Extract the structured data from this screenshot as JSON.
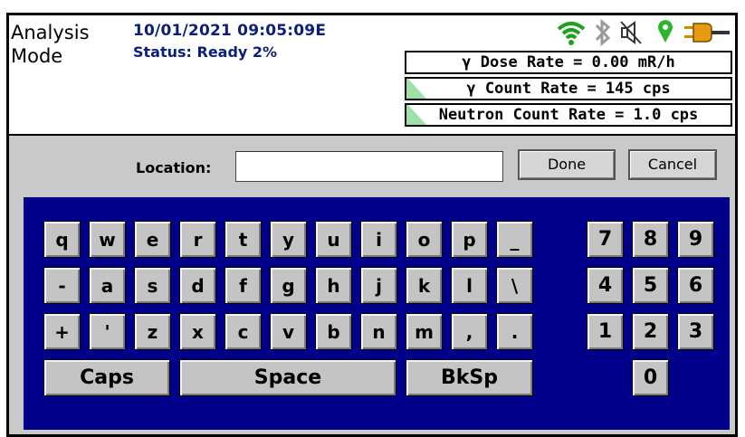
{
  "status_bar": {
    "mode": "Analysis Mode",
    "datetime": "10/01/2021 09:05:09E",
    "status": "Status: Ready 2%",
    "icons": [
      "wifi-icon",
      "bluetooth-icon",
      "speaker-muted-icon",
      "gps-pin-icon",
      "power-plug-icon"
    ],
    "gamma_dose_rate": "γ Dose Rate = 0.00 mR/h",
    "gamma_count_rate": "γ Count Rate = 145 cps",
    "neutron_count_rate": "Neutron Count Rate = 1.0 cps"
  },
  "form": {
    "location_label": "Location:",
    "location_value": "",
    "done_label": "Done",
    "cancel_label": "Cancel"
  },
  "keyboard": {
    "row1": [
      "q",
      "w",
      "e",
      "r",
      "t",
      "y",
      "u",
      "i",
      "o",
      "p",
      "_"
    ],
    "row2": [
      "-",
      "a",
      "s",
      "d",
      "f",
      "g",
      "h",
      "j",
      "k",
      "l",
      "\\"
    ],
    "row3": [
      "+",
      "'",
      "z",
      "x",
      "c",
      "v",
      "b",
      "n",
      "m",
      ",",
      "."
    ],
    "caps": "Caps",
    "space": "Space",
    "bksp": "BkSp",
    "numpad": [
      "7",
      "8",
      "9",
      "4",
      "5",
      "6",
      "1",
      "2",
      "3",
      "0"
    ]
  },
  "colors": {
    "accent_text": "#0c1f7a",
    "keyboard_bg": "#00008a",
    "panel_bg": "#c9c9c9",
    "wifi": "#1fa01f"
  }
}
